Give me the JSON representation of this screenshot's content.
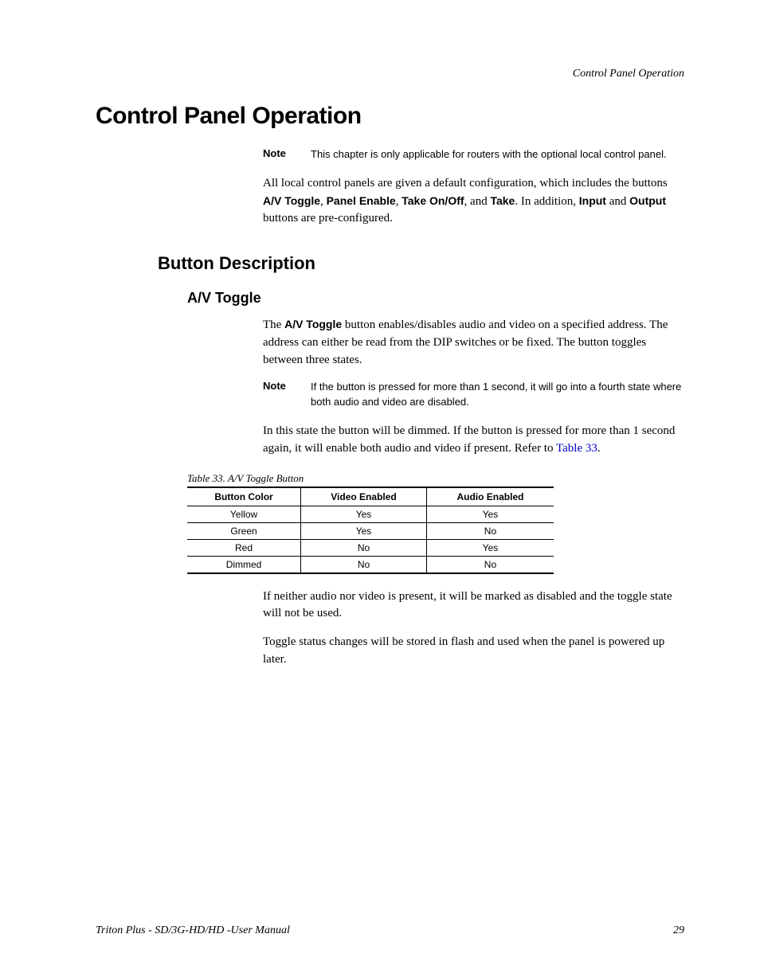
{
  "running_header": "Control Panel Operation",
  "h1": "Control Panel Operation",
  "note1": {
    "label": "Note",
    "text": "This chapter is only applicable for routers with the optional local control panel."
  },
  "intro": {
    "pre": "All local control panels are given a default configuration, which includes the buttons ",
    "b1": "A/V Toggle",
    "sep1": ", ",
    "b2": "Panel Enable",
    "sep2": ", ",
    "b3": "Take On/Off",
    "sep3": ", and ",
    "b4": "Take",
    "sep4": ". In addition, ",
    "b5": "Input",
    "sep5": " and ",
    "b6": "Output",
    "post": " buttons are pre-configured."
  },
  "h2": "Button Description",
  "h3": "A/V Toggle",
  "p1": {
    "pre": "The ",
    "bold": "A/V Toggle",
    "post": " button enables/disables audio and video on a specified address. The address can either be read from the DIP switches or be fixed. The button toggles between three states."
  },
  "note2": {
    "label": "Note",
    "text": "If the button is pressed for more than 1 second, it will go into a fourth state where both audio and video are disabled."
  },
  "p2": {
    "pre": "In this state the button will be dimmed. If the button is pressed for more than 1 second again, it will enable both audio and video if present. Refer to ",
    "xref": "Table 33",
    "post": "."
  },
  "table_caption": "Table 33.  A/V Toggle Button",
  "table": {
    "headers": [
      "Button Color",
      "Video Enabled",
      "Audio Enabled"
    ],
    "rows": [
      [
        "Yellow",
        "Yes",
        "Yes"
      ],
      [
        "Green",
        "Yes",
        "No"
      ],
      [
        "Red",
        "No",
        "Yes"
      ],
      [
        "Dimmed",
        "No",
        "No"
      ]
    ]
  },
  "p3": "If neither audio nor video is present, it will be marked as disabled and the toggle state will not be used.",
  "p4": "Toggle status changes will be stored in flash and used when the panel is powered up later.",
  "footer_left": "Triton Plus - SD/3G-HD/HD -User Manual",
  "footer_right": "29"
}
